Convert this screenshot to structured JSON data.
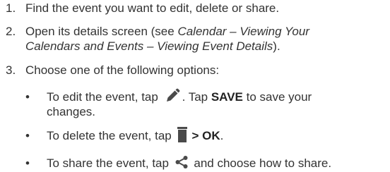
{
  "steps": [
    {
      "number": "1.",
      "text": "Find the event you want to edit, delete or share."
    },
    {
      "number": "2.",
      "line1_prefix": "Open its details screen (see ",
      "line1_italic": "Calendar – Viewing Your",
      "line2_italic": "Calendars and Events – Viewing Event Details",
      "line2_suffix": ")."
    },
    {
      "number": "3.",
      "text": "Choose one of the following options:"
    }
  ],
  "bullets": {
    "dot": "•",
    "edit": {
      "before_icon": "To edit the event, tap ",
      "icon": "pencil-icon",
      "after_icon": ". Tap ",
      "bold": "SAVE",
      "after_bold": " to save your",
      "line2": "changes."
    },
    "delete": {
      "before_icon": "To delete the event, tap ",
      "icon": "trash-icon",
      "bold": "> OK",
      "after_bold": "."
    },
    "share": {
      "before_icon": "To share the event, tap ",
      "icon": "share-icon",
      "after_icon": " and choose how to share."
    }
  },
  "colors": {
    "text": "#333333",
    "icon": "#4a4a4a"
  }
}
